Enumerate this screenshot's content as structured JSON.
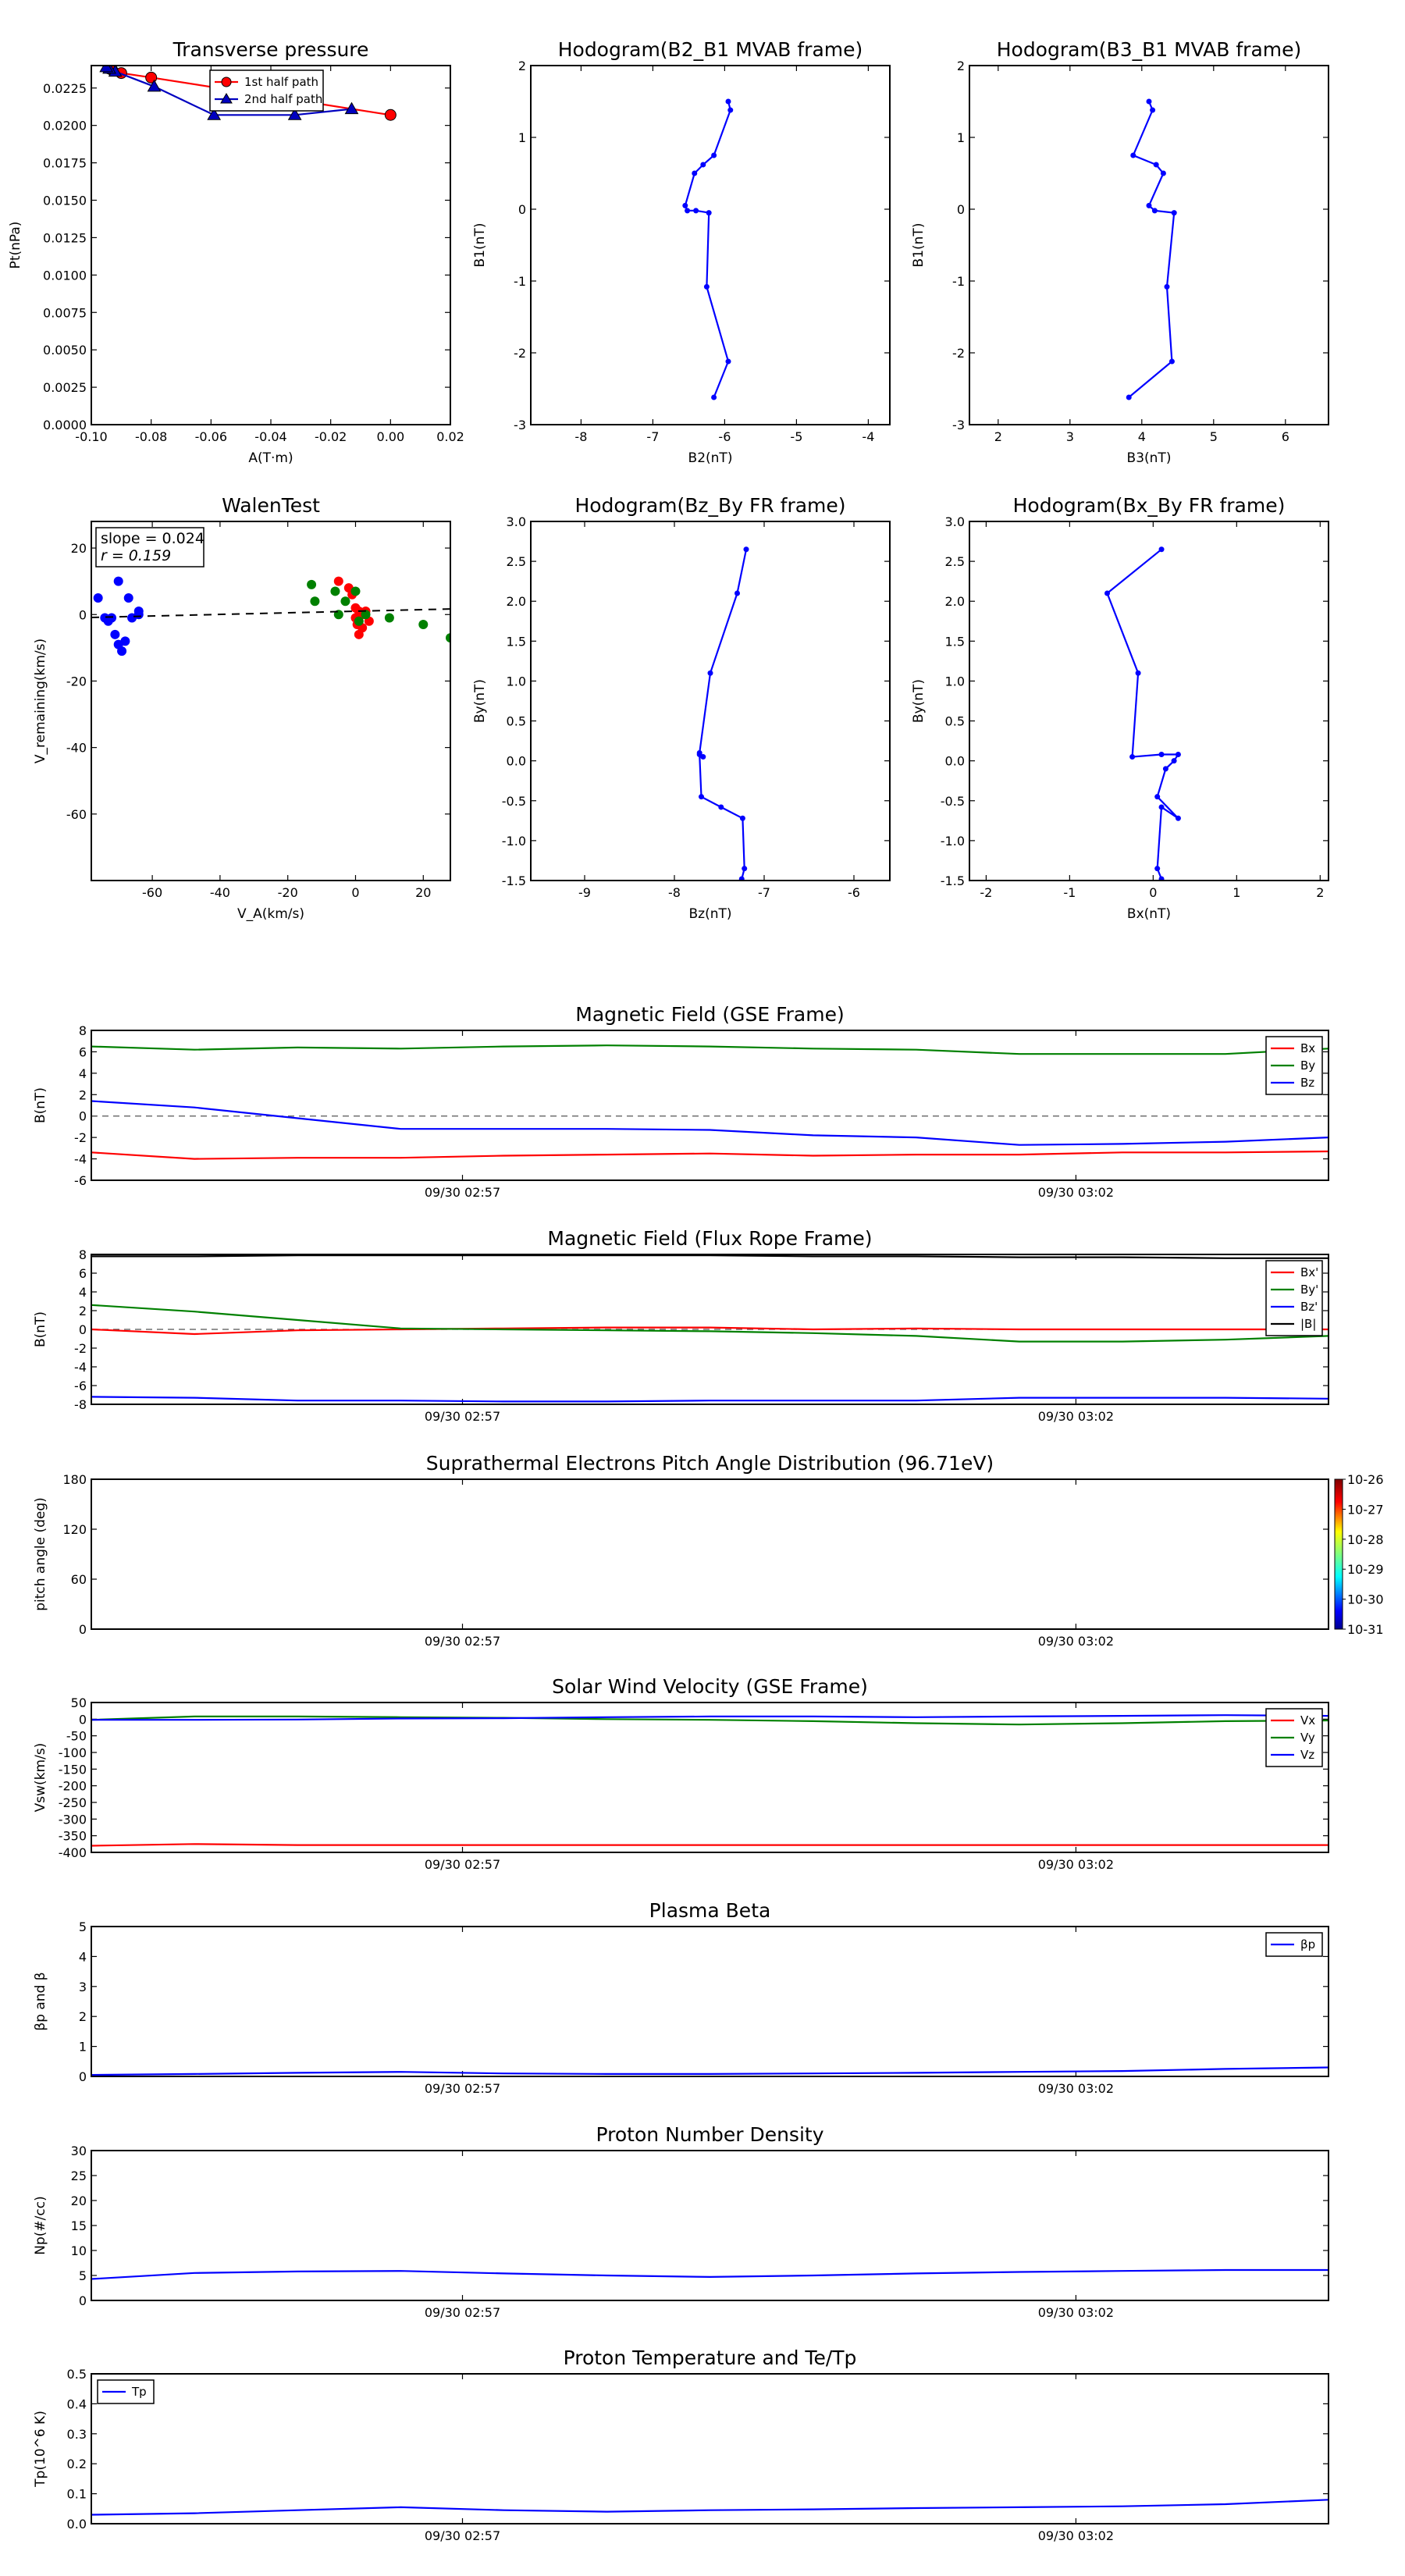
{
  "chart_data": [
    {
      "id": "transverse_pressure",
      "type": "line",
      "title": "Transverse pressure",
      "xlabel": "A(T·m)",
      "ylabel": "Pt(nPa)",
      "xlim": [
        -0.1,
        0.02
      ],
      "ylim": [
        0.0,
        0.024
      ],
      "xticks": [
        "-0.10",
        "-0.08",
        "-0.06",
        "-0.04",
        "-0.02",
        "0.00",
        "0.02"
      ],
      "yticks": [
        "0.0000",
        "0.0025",
        "0.0050",
        "0.0075",
        "0.0100",
        "0.0125",
        "0.0150",
        "0.0175",
        "0.0200",
        "0.0225"
      ],
      "legend": "upper-center",
      "series": [
        {
          "name": "1st half path",
          "color": "#ff0000",
          "marker": "circle",
          "x": [
            0.0,
            -0.08,
            -0.09,
            -0.093,
            -0.094
          ],
          "y": [
            0.0207,
            0.0232,
            0.0235,
            0.0237,
            0.0238
          ]
        },
        {
          "name": "2nd half path",
          "color": "#0000c0",
          "marker": "triangle",
          "x": [
            -0.013,
            -0.032,
            -0.059,
            -0.079,
            -0.092,
            -0.094,
            -0.095
          ],
          "y": [
            0.0211,
            0.0207,
            0.0207,
            0.0226,
            0.0236,
            0.0238,
            0.0239
          ]
        }
      ]
    },
    {
      "id": "hodogram_b2_b1",
      "type": "line",
      "title": "Hodogram(B2_B1 MVAB frame)",
      "xlabel": "B2(nT)",
      "ylabel": "B1(nT)",
      "xlim": [
        -8.7,
        -3.7
      ],
      "ylim": [
        -3,
        2
      ],
      "xticks": [
        "-8",
        "-7",
        "-6",
        "-5",
        "-4"
      ],
      "yticks": [
        "-3",
        "-2",
        "-1",
        "0",
        "1",
        "2"
      ],
      "series": [
        {
          "color": "#0000ff",
          "x": [
            -5.95,
            -5.92,
            -6.15,
            -6.3,
            -6.42,
            -6.55,
            -6.52,
            -6.4,
            -6.22,
            -6.25,
            -5.95,
            -6.15
          ],
          "y": [
            1.5,
            1.38,
            0.75,
            0.62,
            0.5,
            0.05,
            -0.02,
            -0.02,
            -0.05,
            -1.08,
            -2.12,
            -2.62
          ]
        }
      ]
    },
    {
      "id": "hodogram_b3_b1",
      "type": "line",
      "title": "Hodogram(B3_B1 MVAB frame)",
      "xlabel": "B3(nT)",
      "ylabel": "B1(nT)",
      "xlim": [
        1.6,
        6.6
      ],
      "ylim": [
        -3,
        2
      ],
      "xticks": [
        "2",
        "3",
        "4",
        "5",
        "6"
      ],
      "yticks": [
        "-3",
        "-2",
        "-1",
        "0",
        "1",
        "2"
      ],
      "series": [
        {
          "color": "#0000ff",
          "x": [
            4.1,
            4.15,
            3.88,
            4.2,
            4.3,
            4.1,
            4.18,
            4.45,
            4.35,
            4.42,
            3.82
          ],
          "y": [
            1.5,
            1.38,
            0.75,
            0.62,
            0.5,
            0.05,
            -0.02,
            -0.05,
            -1.08,
            -2.12,
            -2.62
          ]
        }
      ]
    },
    {
      "id": "walen_test",
      "type": "scatter",
      "title": "WalenTest",
      "xlabel": "V_A(km/s)",
      "ylabel": "V_remaining(km/s)",
      "xlim": [
        -78,
        28
      ],
      "ylim": [
        -80,
        28
      ],
      "xticks": [
        "-60",
        "-40",
        "-20",
        "0",
        "20"
      ],
      "yticks": [
        "-60",
        "-40",
        "-20",
        "0",
        "20"
      ],
      "annotation": [
        "slope = 0.024",
        "r = 0.159"
      ],
      "fit": {
        "slope": 0.024,
        "intercept": 1.0
      },
      "series": [
        {
          "color": "#0000ff",
          "x": [
            -76,
            -74,
            -73,
            -72,
            -71,
            -70,
            -70,
            -69,
            -68,
            -67,
            -66,
            -64,
            -64
          ],
          "y": [
            5,
            -1,
            -2,
            -1,
            -6,
            10,
            -9,
            -11,
            -8,
            5,
            -1,
            1,
            0
          ]
        },
        {
          "color": "#ff0000",
          "x": [
            -5,
            -2,
            -1,
            0,
            0,
            0.5,
            1,
            1,
            2,
            2,
            3,
            4
          ],
          "y": [
            10,
            8,
            6,
            2,
            -1,
            -3,
            1,
            -6,
            -4,
            0,
            1,
            -2
          ]
        },
        {
          "color": "#008000",
          "x": [
            -13,
            -12,
            -6,
            -5,
            -3,
            0,
            1,
            3,
            10,
            20,
            28
          ],
          "y": [
            9,
            4,
            7,
            0,
            4,
            7,
            -2,
            0,
            -1,
            -3,
            -7
          ]
        }
      ]
    },
    {
      "id": "hodogram_bz_by",
      "type": "line",
      "title": "Hodogram(Bz_By FR frame)",
      "xlabel": "Bz(nT)",
      "ylabel": "By(nT)",
      "xlim": [
        -9.6,
        -5.6
      ],
      "ylim": [
        -1.5,
        3.0
      ],
      "xticks": [
        "-9",
        "-8",
        "-7",
        "-6"
      ],
      "yticks": [
        "-1.5",
        "-1.0",
        "-0.5",
        "0.0",
        "0.5",
        "1.0",
        "1.5",
        "2.0",
        "2.5",
        "3.0"
      ],
      "series": [
        {
          "color": "#0000ff",
          "x": [
            -7.2,
            -7.3,
            -7.6,
            -7.72,
            -7.68,
            -7.72,
            -7.7,
            -7.48,
            -7.24,
            -7.22,
            -7.25
          ],
          "y": [
            2.65,
            2.1,
            1.1,
            0.1,
            0.05,
            0.08,
            -0.45,
            -0.58,
            -0.72,
            -1.35,
            -1.48
          ]
        }
      ]
    },
    {
      "id": "hodogram_bx_by",
      "type": "line",
      "title": "Hodogram(Bx_By FR frame)",
      "xlabel": "Bx(nT)",
      "ylabel": "By(nT)",
      "xlim": [
        -2.2,
        2.1
      ],
      "ylim": [
        -1.5,
        3.0
      ],
      "xticks": [
        "-2",
        "-1",
        "0",
        "1",
        "2"
      ],
      "yticks": [
        "-1.5",
        "-1.0",
        "-0.5",
        "0.0",
        "0.5",
        "1.0",
        "1.5",
        "2.0",
        "2.5",
        "3.0"
      ],
      "series": [
        {
          "color": "#0000ff",
          "x": [
            0.1,
            -0.55,
            -0.18,
            -0.25,
            0.1,
            0.3,
            0.25,
            0.15,
            0.05,
            0.3,
            0.1,
            0.05,
            0.1
          ],
          "y": [
            2.65,
            2.1,
            1.1,
            0.05,
            0.08,
            0.08,
            0.0,
            -0.1,
            -0.45,
            -0.72,
            -0.58,
            -1.35,
            -1.48
          ]
        }
      ]
    },
    {
      "id": "magnetic_field_gse",
      "type": "line",
      "title": "Magnetic Field (GSE Frame)",
      "xlabel": "",
      "ylabel": "B(nT)",
      "xlim": [
        0,
        12
      ],
      "ylim": [
        -6,
        8
      ],
      "xtick_pos": [
        3.6,
        9.55
      ],
      "xticks": [
        "09/30 02:57",
        "09/30 03:02"
      ],
      "yticks": [
        "-6",
        "-4",
        "-2",
        "0",
        "2",
        "4",
        "6",
        "8"
      ],
      "zero_line": true,
      "legend": "upper-right",
      "series": [
        {
          "name": "Bx",
          "color": "#ff0000",
          "x": [
            0,
            1,
            2,
            3,
            4,
            5,
            6,
            7,
            8,
            9,
            10,
            11,
            12
          ],
          "y": [
            -3.4,
            -4.0,
            -3.9,
            -3.9,
            -3.7,
            -3.6,
            -3.5,
            -3.7,
            -3.6,
            -3.6,
            -3.4,
            -3.4,
            -3.3
          ]
        },
        {
          "name": "By",
          "color": "#008000",
          "x": [
            0,
            1,
            2,
            3,
            4,
            5,
            6,
            7,
            8,
            9,
            10,
            11,
            12
          ],
          "y": [
            6.5,
            6.2,
            6.4,
            6.3,
            6.5,
            6.6,
            6.5,
            6.3,
            6.2,
            5.8,
            5.8,
            5.8,
            6.3
          ]
        },
        {
          "name": "Bz",
          "color": "#0000ff",
          "x": [
            0,
            1,
            2,
            3,
            4,
            5,
            6,
            7,
            8,
            9,
            10,
            11,
            12
          ],
          "y": [
            1.4,
            0.8,
            -0.2,
            -1.2,
            -1.2,
            -1.2,
            -1.3,
            -1.8,
            -2.0,
            -2.7,
            -2.6,
            -2.4,
            -2.0
          ]
        }
      ]
    },
    {
      "id": "magnetic_field_fr",
      "type": "line",
      "title": "Magnetic Field (Flux Rope Frame)",
      "xlabel": "",
      "ylabel": "B(nT)",
      "xlim": [
        0,
        12
      ],
      "ylim": [
        -8,
        8
      ],
      "xtick_pos": [
        3.6,
        9.55
      ],
      "xticks": [
        "09/30 02:57",
        "09/30 03:02"
      ],
      "yticks": [
        "-8",
        "-6",
        "-4",
        "-2",
        "0",
        "2",
        "4",
        "6",
        "8"
      ],
      "zero_line": true,
      "legend": "upper-right",
      "series": [
        {
          "name": "Bx'",
          "color": "#ff0000",
          "x": [
            0,
            1,
            2,
            3,
            4,
            5,
            6,
            7,
            8,
            9,
            10,
            11,
            12
          ],
          "y": [
            0.0,
            -0.5,
            -0.1,
            0.0,
            0.1,
            0.2,
            0.2,
            0.0,
            0.1,
            0.0,
            0.0,
            0.0,
            0.0
          ]
        },
        {
          "name": "By'",
          "color": "#008000",
          "x": [
            0,
            1,
            2,
            3,
            4,
            5,
            6,
            7,
            8,
            9,
            10,
            11,
            12
          ],
          "y": [
            2.6,
            1.9,
            1.0,
            0.1,
            0.0,
            -0.1,
            -0.2,
            -0.4,
            -0.7,
            -1.3,
            -1.3,
            -1.1,
            -0.7
          ]
        },
        {
          "name": "Bz'",
          "color": "#0000ff",
          "x": [
            0,
            1,
            2,
            3,
            4,
            5,
            6,
            7,
            8,
            9,
            10,
            11,
            12
          ],
          "y": [
            -7.2,
            -7.3,
            -7.6,
            -7.6,
            -7.7,
            -7.7,
            -7.6,
            -7.6,
            -7.6,
            -7.3,
            -7.3,
            -7.3,
            -7.4
          ]
        },
        {
          "name": "|B|",
          "color": "#000000",
          "x": [
            0,
            1,
            2,
            3,
            4,
            5,
            6,
            7,
            8,
            9,
            10,
            11,
            12
          ],
          "y": [
            7.8,
            7.8,
            7.9,
            7.9,
            7.9,
            7.9,
            7.9,
            7.8,
            7.8,
            7.7,
            7.7,
            7.6,
            7.6
          ]
        }
      ]
    },
    {
      "id": "suprathermal_pad",
      "type": "heatmap",
      "title": "Suprathermal Electrons Pitch Angle Distribution (96.71eV)",
      "xlabel": "",
      "ylabel": "pitch angle (deg)",
      "xlim": [
        0,
        12
      ],
      "ylim": [
        0,
        180
      ],
      "xtick_pos": [
        3.6,
        9.55
      ],
      "xticks": [
        "09/30 02:57",
        "09/30 03:02"
      ],
      "yticks": [
        "0",
        "60",
        "120",
        "180"
      ],
      "colorbar": {
        "ticks": [
          "10-26",
          "10-27",
          "10-28",
          "10-29",
          "10-30",
          "10-31"
        ]
      },
      "values": []
    },
    {
      "id": "solar_wind_velocity",
      "type": "line",
      "title": "Solar Wind Velocity (GSE Frame)",
      "xlabel": "",
      "ylabel": "Vsw(km/s)",
      "xlim": [
        0,
        12
      ],
      "ylim": [
        -400,
        50
      ],
      "xtick_pos": [
        3.6,
        9.55
      ],
      "xticks": [
        "09/30 02:57",
        "09/30 03:02"
      ],
      "yticks": [
        "-400",
        "-350",
        "-300",
        "-250",
        "-200",
        "-150",
        "-100",
        "-50",
        "0",
        "50"
      ],
      "legend": "upper-right",
      "series": [
        {
          "name": "Vx",
          "color": "#ff0000",
          "x": [
            0,
            1,
            2,
            3,
            4,
            5,
            6,
            7,
            8,
            9,
            10,
            11,
            12
          ],
          "y": [
            -380,
            -375,
            -378,
            -378,
            -378,
            -378,
            -378,
            -378,
            -378,
            -378,
            -378,
            -378,
            -378
          ]
        },
        {
          "name": "Vy",
          "color": "#008000",
          "x": [
            0,
            1,
            2,
            3,
            4,
            5,
            6,
            7,
            8,
            9,
            10,
            11,
            12
          ],
          "y": [
            -2,
            8,
            8,
            6,
            4,
            0,
            -2,
            -6,
            -12,
            -16,
            -12,
            -6,
            -4
          ]
        },
        {
          "name": "Vz",
          "color": "#0000ff",
          "x": [
            0,
            1,
            2,
            3,
            4,
            5,
            6,
            7,
            8,
            9,
            10,
            11,
            12
          ],
          "y": [
            -2,
            -2,
            -1,
            2,
            3,
            6,
            8,
            8,
            6,
            8,
            10,
            12,
            10
          ]
        }
      ]
    },
    {
      "id": "plasma_beta",
      "type": "line",
      "title": "Plasma Beta",
      "xlabel": "",
      "ylabel": "βp and β",
      "xlim": [
        0,
        12
      ],
      "ylim": [
        0,
        5
      ],
      "xtick_pos": [
        3.6,
        9.55
      ],
      "xticks": [
        "09/30 02:57",
        "09/30 03:02"
      ],
      "yticks": [
        "0",
        "1",
        "2",
        "3",
        "4",
        "5"
      ],
      "legend": "upper-right",
      "series": [
        {
          "name": "βp",
          "color": "#0000ff",
          "x": [
            0,
            1,
            2,
            3,
            4,
            5,
            6,
            7,
            8,
            9,
            10,
            11,
            12
          ],
          "y": [
            0.05,
            0.08,
            0.12,
            0.15,
            0.1,
            0.08,
            0.08,
            0.1,
            0.12,
            0.15,
            0.18,
            0.25,
            0.3
          ]
        }
      ]
    },
    {
      "id": "proton_density",
      "type": "line",
      "title": "Proton Number Density",
      "xlabel": "",
      "ylabel": "Np(#/cc)",
      "xlim": [
        0,
        12
      ],
      "ylim": [
        0,
        30
      ],
      "xtick_pos": [
        3.6,
        9.55
      ],
      "xticks": [
        "09/30 02:57",
        "09/30 03:02"
      ],
      "yticks": [
        "0",
        "5",
        "10",
        "15",
        "20",
        "25",
        "30"
      ],
      "series": [
        {
          "color": "#0000ff",
          "x": [
            0,
            1,
            2,
            3,
            4,
            5,
            6,
            7,
            8,
            9,
            10,
            11,
            12
          ],
          "y": [
            4.3,
            5.5,
            5.8,
            5.9,
            5.4,
            5.0,
            4.7,
            5.0,
            5.4,
            5.7,
            5.9,
            6.1,
            6.1
          ]
        }
      ]
    },
    {
      "id": "proton_temperature",
      "type": "line",
      "title": "Proton Temperature and Te/Tp",
      "xlabel": "",
      "ylabel": "Tp(10^6 K)",
      "xlim": [
        0,
        12
      ],
      "ylim": [
        0,
        0.5
      ],
      "xtick_pos": [
        3.6,
        9.55
      ],
      "xticks": [
        "09/30 02:57",
        "09/30 03:02"
      ],
      "yticks": [
        "0.0",
        "0.1",
        "0.2",
        "0.3",
        "0.4",
        "0.5"
      ],
      "legend": "upper-left",
      "series": [
        {
          "name": "Tp",
          "color": "#0000ff",
          "x": [
            0,
            1,
            2,
            3,
            4,
            5,
            6,
            7,
            8,
            9,
            10,
            11,
            12
          ],
          "y": [
            0.03,
            0.035,
            0.045,
            0.055,
            0.045,
            0.04,
            0.045,
            0.048,
            0.052,
            0.055,
            0.058,
            0.065,
            0.08
          ]
        }
      ]
    }
  ]
}
